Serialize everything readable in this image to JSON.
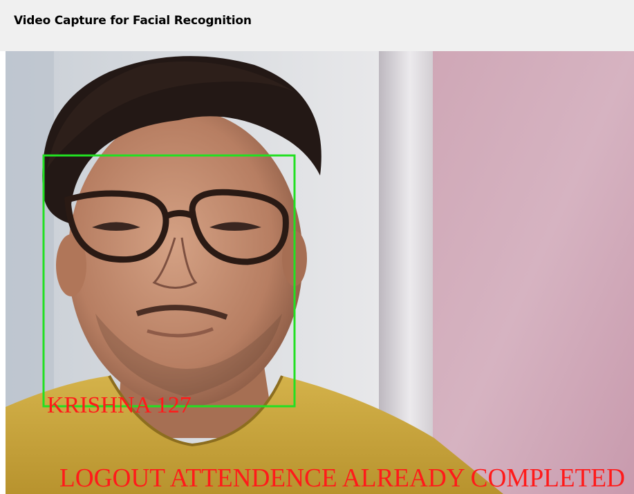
{
  "window": {
    "title": "Video Capture for Facial Recognition"
  },
  "recognition": {
    "person_label": "KRISHNA 127",
    "status_message": "LOGOUT ATTENDENCE ALREADY COMPLETED"
  },
  "colors": {
    "face_box": "#22e022",
    "overlay_text": "#ff1a1a"
  }
}
